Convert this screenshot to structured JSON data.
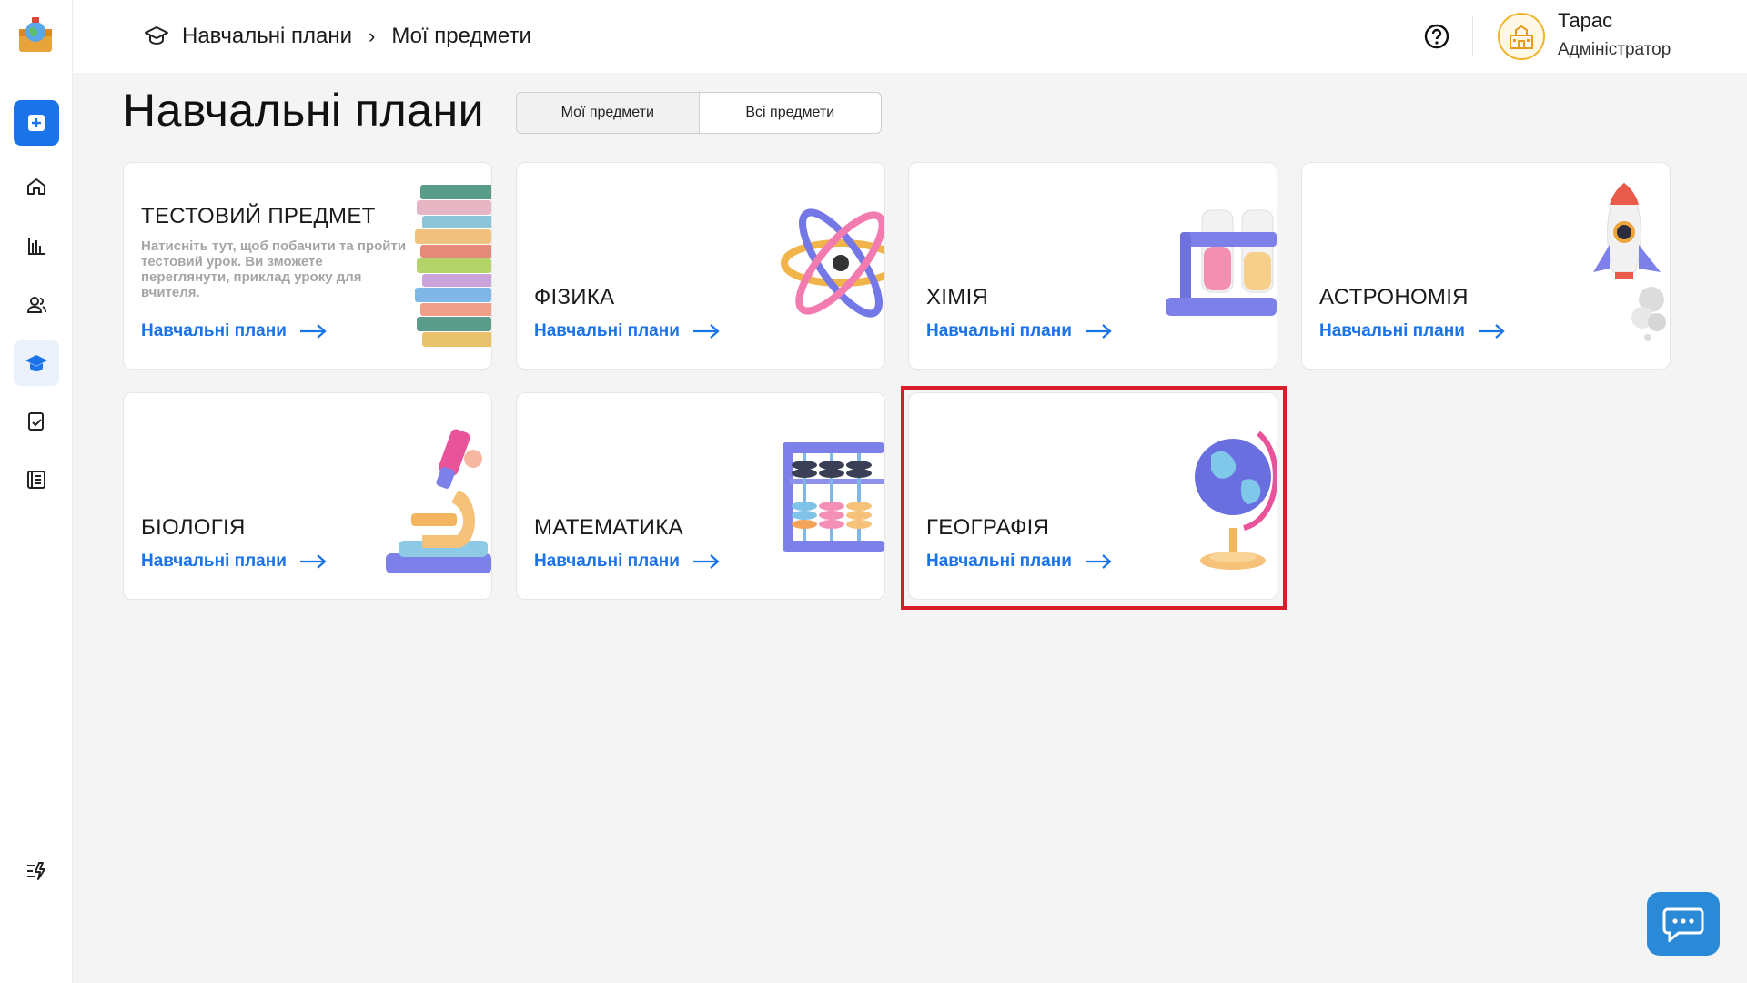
{
  "header": {
    "breadcrumb": [
      "Навчальні плани",
      "Мої предмети"
    ],
    "breadcrumb_separator": "›",
    "user_name": "Тарас",
    "user_role": "Адміністратор"
  },
  "page": {
    "title": "Навчальні плани",
    "tabs": [
      {
        "label": "Мої предмети",
        "active": true
      },
      {
        "label": "Всі предмети",
        "active": false
      }
    ]
  },
  "cards": [
    {
      "title": "ТЕСТОВИЙ ПРЕДМЕТ",
      "description": "Натисніть тут, щоб побачити та пройти тестовий урок. Ви зможете переглянути, приклад уроку для вчителя.",
      "link": "Навчальні плани",
      "icon": "books-icon"
    },
    {
      "title": "ФІЗИКА",
      "link": "Навчальні плани",
      "icon": "atom-icon"
    },
    {
      "title": "ХІМІЯ",
      "link": "Навчальні плани",
      "icon": "test-tubes-icon"
    },
    {
      "title": "АСТРОНОМІЯ",
      "link": "Навчальні плани",
      "icon": "rocket-icon"
    },
    {
      "title": "БІОЛОГІЯ",
      "link": "Навчальні плани",
      "icon": "microscope-icon"
    },
    {
      "title": "МАТЕМАТИКА",
      "link": "Навчальні плани",
      "icon": "abacus-icon"
    },
    {
      "title": "ГЕОГРАФІЯ",
      "link": "Навчальні плани",
      "icon": "globe-icon",
      "highlighted": true
    }
  ],
  "sidebar": {
    "items": [
      "add-icon",
      "home-icon",
      "stats-icon",
      "users-icon",
      "graduation-cap-icon",
      "task-icon",
      "journal-icon",
      "automation-icon"
    ],
    "active": "graduation-cap-icon"
  },
  "colors": {
    "accent": "#1a73e8",
    "highlight": "#d81e2a",
    "chat": "#2a8ad8"
  }
}
